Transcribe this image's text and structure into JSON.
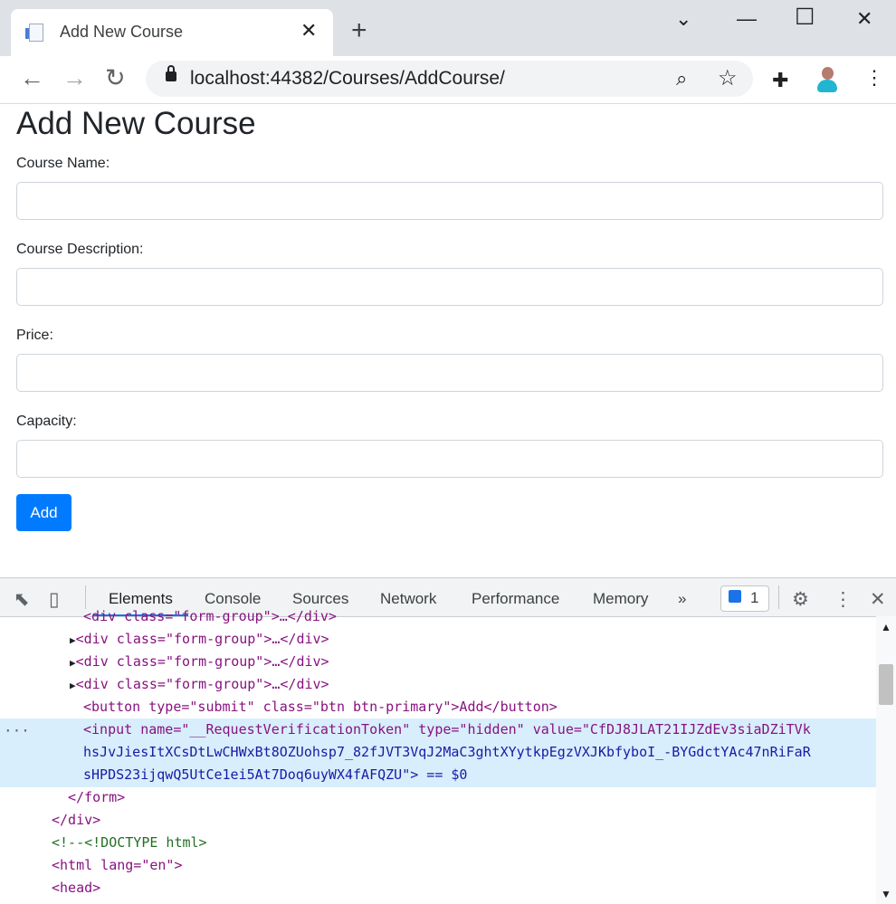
{
  "browser": {
    "tab_title": "Add New Course",
    "tab_close": "✕",
    "new_tab": "+",
    "url_host": "localhost",
    "url_path": ":44382/Courses/AddCourse/",
    "window_controls": [
      "⌄",
      "—",
      "☐",
      "✕"
    ],
    "icons": {
      "back": "back-icon",
      "forward": "forward-icon",
      "reload": "reload-icon",
      "zoom": "zoom-icon",
      "star": "bookmark-star-icon",
      "extensions": "puzzle-icon",
      "menu": "menu-dots-icon"
    }
  },
  "page": {
    "title": "Add New Course",
    "labels": [
      "Course Name:",
      "Course Description:",
      "Price:",
      "Capacity:"
    ],
    "button": "Add",
    "accent": "#007bff"
  },
  "devtools": {
    "tabs": [
      "Elements",
      "Console",
      "Sources",
      "Network",
      "Performance",
      "Memory"
    ],
    "more": "»",
    "issues_count": "1",
    "code": {
      "line0": "<div class=\"form-group\">…</div>",
      "line1": "<div class=\"form-group\">…</div>",
      "line2": "<div class=\"form-group\">…</div>",
      "line3": "<div class=\"form-group\">…</div>",
      "line4": "<button type=\"submit\" class=\"btn btn-primary\">Add</button>",
      "line5": "<input name=\"__RequestVerificationToken\" type=\"hidden\" value=\"CfDJ8JLAT21IJZdEv3siaDZiTVk",
      "line6": "hsJvJiesItXCsDtLwCHWxBt8OZUohsp7_82fJVT3VqJ2MaC3ghtXYytkpEgzVXJKbfyboI_-BYGdctYAc47nRiFaR",
      "line7": "sHPDS23ijqwQ5UtCe1ei5At7Doq6uyWX4fAFQZU\"> == $0",
      "line8": "</form>",
      "line9": "</div>",
      "line10": "<!--<!DOCTYPE html>",
      "line11": "<html lang=\"en\">",
      "line12": "<head>"
    }
  }
}
